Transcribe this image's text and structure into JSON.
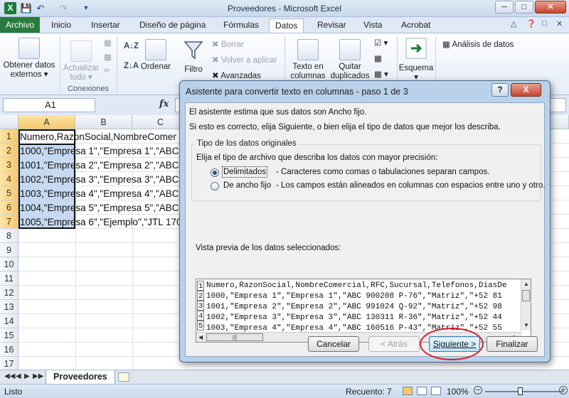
{
  "window": {
    "title": "Proveedores - Microsoft Excel",
    "app_icon": "X",
    "quick_access": [
      "save-icon",
      "undo-icon",
      "redo-icon",
      "customize-icon"
    ],
    "controls": [
      "minimize-icon",
      "maximize-icon",
      "close-icon"
    ]
  },
  "ribbon": {
    "tabs": [
      "Archivo",
      "Inicio",
      "Insertar",
      "Diseño de página",
      "Fórmulas",
      "Datos",
      "Revisar",
      "Vista",
      "Acrobat"
    ],
    "active_tab": "Datos",
    "buttons": {
      "obtener_datos_1": "Obtener datos",
      "obtener_datos_2": "externos",
      "actualizar_1": "Actualizar",
      "actualizar_2": "todo",
      "ordenar": "Ordenar",
      "filtro": "Filtro",
      "borrar": "Borrar",
      "volver_aplicar": "Volver a aplicar",
      "avanzadas": "Avanzadas",
      "texto_columnas_1": "Texto en",
      "texto_columnas_2": "columnas",
      "quitar_dup_1": "Quitar",
      "quitar_dup_2": "duplicados",
      "esquema": "Esquema",
      "analisis": "Análisis de datos"
    },
    "groups": {
      "conexiones": "Conexiones"
    }
  },
  "formula_bar": {
    "name_box": "A1",
    "fx": "fx",
    "formula": ""
  },
  "sheet": {
    "columns": [
      "A",
      "B",
      "C"
    ],
    "rows": [
      "1",
      "2",
      "3",
      "4",
      "5",
      "6",
      "7",
      "8",
      "9",
      "10",
      "11",
      "12",
      "13",
      "14",
      "15",
      "16",
      "17"
    ],
    "cells": [
      "Numero,RazonSocial,NombreComer",
      "1000,\"Empresa 1\",\"Empresa 1\",\"ABC",
      "1001,\"Empresa 2\",\"Empresa 2\",\"ABC",
      "1002,\"Empresa 3\",\"Empresa 3\",\"ABC",
      "1003,\"Empresa 4\",\"Empresa 4\",\"ABC",
      "1004,\"Empresa 5\",\"Empresa 5\",\"ABC",
      "1005,\"Empresa 6\",\"Ejemplo\",\"JTL 170"
    ],
    "tab_name": "Proveedores"
  },
  "status": {
    "ready": "Listo",
    "count": "Recuento: 7",
    "zoom": "100%"
  },
  "dialog": {
    "title": "Asistente para convertir texto en columnas - paso 1 de 3",
    "help": "?",
    "close": "X",
    "line1": "El asistente estima que sus datos son Ancho fijo.",
    "line2": "Si esto es correcto, elija Siguiente, o bien elija el tipo de datos que mejor los describa.",
    "group_title": "Tipo de los datos originales",
    "group_prompt": "Elija el tipo de archivo que describa los datos con mayor precisión:",
    "options": [
      {
        "label": "Delimitados",
        "desc": "- Caracteres como comas o tabulaciones separan campos.",
        "selected": true
      },
      {
        "label": "De ancho fijo",
        "desc": "- Los campos están alineados en columnas con espacios entre uno y otro.",
        "selected": false
      }
    ],
    "preview_label": "Vista previa de los datos seleccionados:",
    "preview_row_numbers": [
      "1",
      "2",
      "3",
      "4",
      "5"
    ],
    "preview_lines": [
      "Numero,RazonSocial,NombreComercial,RFC,Sucursal,Telefonos,DiasDe",
      "1000,\"Empresa 1\",\"Empresa 1\",\"ABC 900208 P-76\",\"Matriz\",\"+52 81",
      "1001,\"Empresa 2\",\"Empresa 2\",\"ABC 991024 Q-92\",\"Matriz\",\"+52 98",
      "1002,\"Empresa 3\",\"Empresa 3\",\"ABC 130311 R-36\",\"Matriz\",\"+52 44",
      "1003,\"Empresa 4\",\"Empresa 4\",\"ABC 160516 P-43\",\"Matriz\",\"+52 55"
    ],
    "buttons": {
      "cancel": "Cancelar",
      "back": "< Atrás",
      "next": "Siguiente >",
      "finish": "Finalizar"
    }
  },
  "highlight_color": "#d1202a"
}
